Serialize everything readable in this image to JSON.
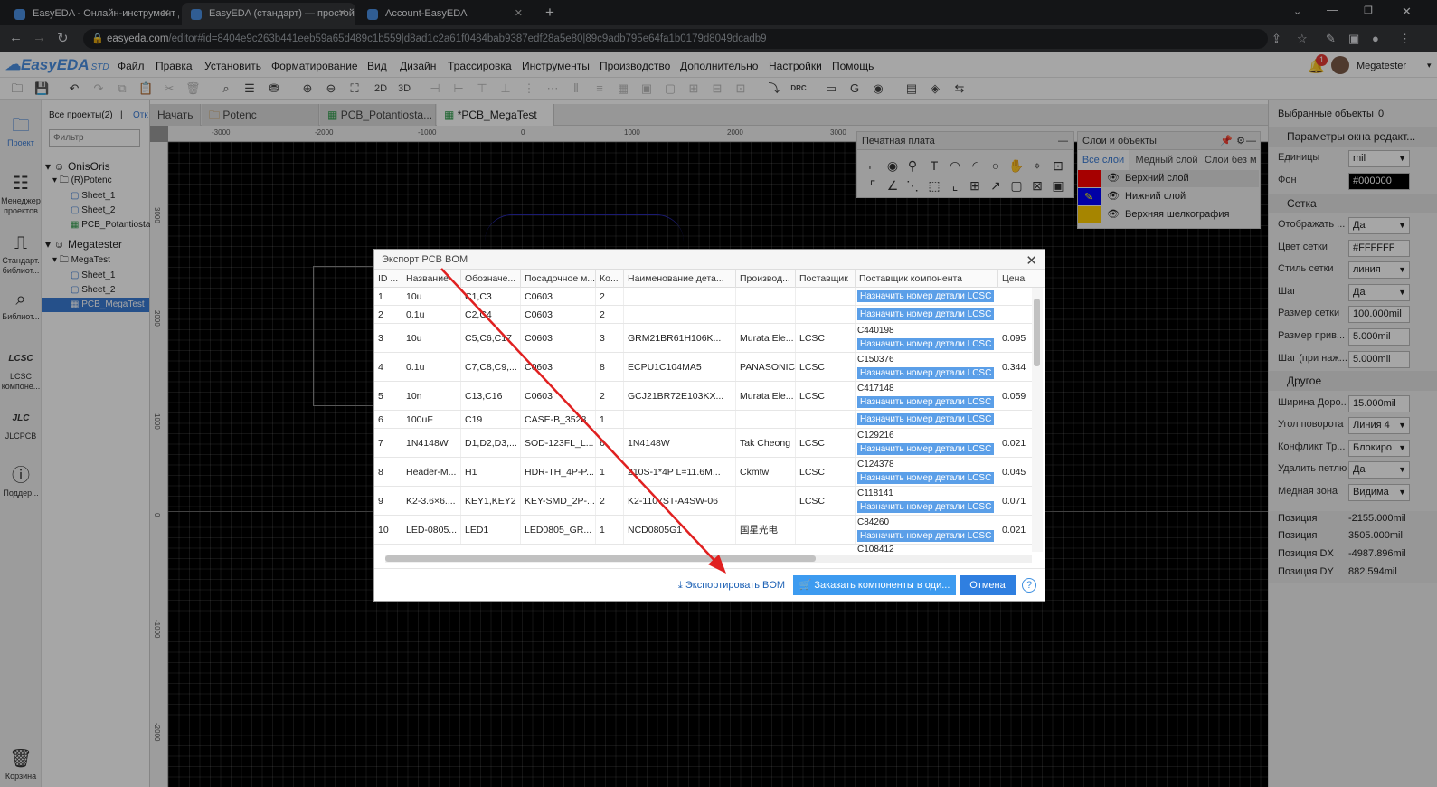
{
  "browser": {
    "tabs": [
      {
        "title": "EasyEDA - Онлайн-инструмент д",
        "active": false
      },
      {
        "title": "EasyEDA (стандарт) — простой и",
        "active": true
      },
      {
        "title": "Account-EasyEDA",
        "active": false
      }
    ],
    "url_host": "easyeda.com",
    "url_path": "/editor#id=8404e9c263b441eeb59a65d489c1b559|d8ad1c2a61f0484bab9387edf28a5e80|89c9adb795e64fa1b0179d8049dcadb9"
  },
  "app": {
    "logo": "EasyEDA",
    "logo_sub": "STD",
    "menu": [
      "Файл",
      "Правка",
      "Установить",
      "Форматирование",
      "Вид",
      "Дизайн",
      "Трассировка",
      "Инструменты",
      "Производство",
      "Дополнительно",
      "Настройки",
      "Помощь"
    ],
    "notif_count": "1",
    "username": "Megatester",
    "toolbar_2d": "2D",
    "toolbar_3d": "3D",
    "toolbar_drc": "DRC"
  },
  "leftnav": {
    "items": [
      "Проект",
      "Менеджер проектов",
      "Стандарт. библиот...",
      "Библиот...",
      "LCSC компоне...",
      "JLCPCB",
      "Поддер...",
      "Корзина"
    ]
  },
  "tree": {
    "header_projects": "Все проекты(2)",
    "header_sep": "|",
    "header_open": "Отк",
    "filter_placeholder": "Фильтр",
    "items": [
      {
        "label": "OnisOris"
      },
      {
        "label": "(R)Potenc"
      },
      {
        "label": "Sheet_1"
      },
      {
        "label": "Sheet_2"
      },
      {
        "label": "PCB_Potantiosta"
      },
      {
        "label": "Megatester"
      },
      {
        "label": "MegaTest"
      },
      {
        "label": "Sheet_1"
      },
      {
        "label": "Sheet_2"
      },
      {
        "label": "PCB_MegaTest"
      }
    ]
  },
  "doctabs": [
    "Начать",
    "Potenc",
    "PCB_Potantiosta...",
    "*PCB_MegaTest"
  ],
  "ruler": {
    "h": [
      "-3000",
      "-2000",
      "-1000",
      "0",
      "1000",
      "2000",
      "3000"
    ],
    "v": [
      "3000",
      "2000",
      "1000",
      "0",
      "-1000",
      "-2000"
    ]
  },
  "pcb_panel": {
    "title": "Печатная плата"
  },
  "layers_panel": {
    "title": "Слои и объекты",
    "tabs": [
      "Все слои",
      "Медный слой",
      "Слои без м"
    ],
    "rows": [
      {
        "name": "Верхний слой",
        "color": "#ff0000"
      },
      {
        "name": "Нижний слой",
        "color": "#0000ff"
      },
      {
        "name": "Верхняя шелкография",
        "color": "#ffcc00"
      }
    ]
  },
  "right_panel": {
    "selected_label": "Выбранные объекты",
    "selected_count": "0",
    "section_params": "Параметры окна редакт...",
    "units_label": "Единицы",
    "units_value": "mil",
    "bg_label": "Фон",
    "bg_value": "#000000",
    "section_grid": "Сетка",
    "grid_rows": [
      {
        "label": "Отображать ...",
        "value": "Да"
      },
      {
        "label": "Цвет сетки",
        "value": "#FFFFFF"
      },
      {
        "label": "Стиль сетки",
        "value": "линия"
      },
      {
        "label": "Шаг",
        "value": "Да"
      },
      {
        "label": "Размер сетки",
        "value": "100.000mil"
      },
      {
        "label": "Размер прив...",
        "value": "5.000mil"
      },
      {
        "label": "Шаг (при наж...",
        "value": "5.000mil"
      }
    ],
    "section_other": "Другое",
    "other_rows": [
      {
        "label": "Ширина Доро...",
        "value": "15.000mil"
      },
      {
        "label": "Угол поворота",
        "value": "Линия 4"
      },
      {
        "label": "Конфликт Тр...",
        "value": "Блокиро"
      },
      {
        "label": "Удалить петлю",
        "value": "Да"
      },
      {
        "label": "Медная зона",
        "value": "Видима"
      }
    ],
    "positions": [
      {
        "label": "Позиция",
        "value": "-2155.000mil"
      },
      {
        "label": "Позиция",
        "value": "3505.000mil"
      },
      {
        "label": "Позиция DX",
        "value": "-4987.896mil"
      },
      {
        "label": "Позиция DY",
        "value": "882.594mil"
      }
    ]
  },
  "modal": {
    "title": "Экспорт PCB BOM",
    "columns": [
      "ID ...",
      "Название",
      "Обозначе...",
      "Посадочное м...",
      "Ко...",
      "Наименование дета...",
      "Производ...",
      "Поставщик",
      "Поставщик компонента",
      "Цена"
    ],
    "assign_label": "Назначить номер детали LCSC",
    "rows": [
      {
        "id": "1",
        "name": "10u",
        "des": "C1,C3",
        "fp": "C0603",
        "qty": "2",
        "part": "",
        "mfr": "",
        "sup": "",
        "cnum": "",
        "price": ""
      },
      {
        "id": "2",
        "name": "0.1u",
        "des": "C2,C4",
        "fp": "C0603",
        "qty": "2",
        "part": "",
        "mfr": "",
        "sup": "",
        "cnum": "",
        "price": ""
      },
      {
        "id": "3",
        "name": "10u",
        "des": "C5,C6,C17",
        "fp": "C0603",
        "qty": "3",
        "part": "GRM21BR61H106K...",
        "mfr": "Murata Ele...",
        "sup": "LCSC",
        "cnum": "C440198",
        "price": "0.095"
      },
      {
        "id": "4",
        "name": "0.1u",
        "des": "C7,C8,C9,...",
        "fp": "C0603",
        "qty": "8",
        "part": "ECPU1C104MA5",
        "mfr": "PANASONIC",
        "sup": "LCSC",
        "cnum": "C150376",
        "price": "0.344"
      },
      {
        "id": "5",
        "name": "10n",
        "des": "C13,C16",
        "fp": "C0603",
        "qty": "2",
        "part": "GCJ21BR72E103KX...",
        "mfr": "Murata Ele...",
        "sup": "LCSC",
        "cnum": "C417148",
        "price": "0.059"
      },
      {
        "id": "6",
        "name": "100uF",
        "des": "C19",
        "fp": "CASE-B_3528",
        "qty": "1",
        "part": "",
        "mfr": "",
        "sup": "",
        "cnum": "",
        "price": ""
      },
      {
        "id": "7",
        "name": "1N4148W",
        "des": "D1,D2,D3,...",
        "fp": "SOD-123FL_L...",
        "qty": "6",
        "part": "1N4148W",
        "mfr": "Tak Cheong",
        "sup": "LCSC",
        "cnum": "C129216",
        "price": "0.021"
      },
      {
        "id": "8",
        "name": "Header-M...",
        "des": "H1",
        "fp": "HDR-TH_4P-P...",
        "qty": "1",
        "part": "210S-1*4P L=11.6M...",
        "mfr": "Ckmtw",
        "sup": "LCSC",
        "cnum": "C124378",
        "price": "0.045"
      },
      {
        "id": "9",
        "name": "K2-3.6×6....",
        "des": "KEY1,KEY2",
        "fp": "KEY-SMD_2P-...",
        "qty": "2",
        "part": "K2-1107ST-A4SW-06",
        "mfr": "",
        "sup": "LCSC",
        "cnum": "C118141",
        "price": "0.071"
      },
      {
        "id": "10",
        "name": "LED-0805...",
        "des": "LED1",
        "fp": "LED0805_GR...",
        "qty": "1",
        "part": "NCD0805G1",
        "mfr": "国星光电",
        "sup": "",
        "cnum": "C84260",
        "price": "0.021"
      },
      {
        "id": "",
        "name": "",
        "des": "",
        "fp": "",
        "qty": "",
        "part": "",
        "mfr": "",
        "sup": "",
        "cnum": "C108412",
        "price": ""
      }
    ],
    "export_label": "Экспортировать BOM",
    "order_label": "Заказать компоненты в оди...",
    "cancel_label": "Отмена"
  },
  "colors": {
    "accent": "#4a90e2",
    "lcsc_button": "#5b9fe8",
    "annotation_arrow": "#e02020"
  }
}
